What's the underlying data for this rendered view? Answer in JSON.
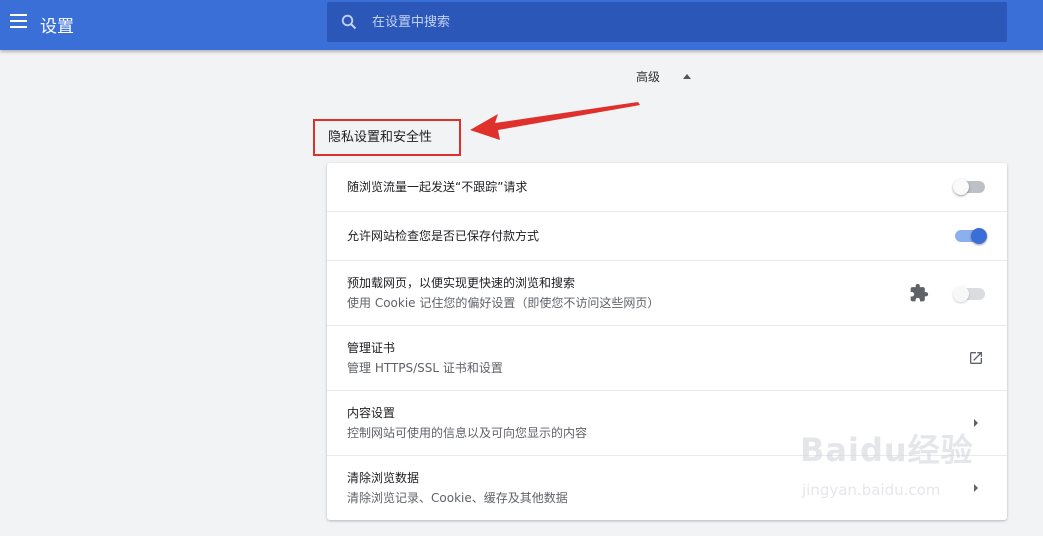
{
  "header": {
    "title": "设置",
    "search_placeholder": "在设置中搜索",
    "color": "#3b6fd8"
  },
  "advanced": {
    "label": "高级"
  },
  "section": {
    "title": "隐私设置和安全性",
    "highlight_color": "#e0302b"
  },
  "rows": [
    {
      "primary": "随浏览流量一起发送“不跟踪”请求",
      "control": "toggle",
      "state": "off"
    },
    {
      "primary": "允许网站检查您是否已保存付款方式",
      "control": "toggle",
      "state": "on"
    },
    {
      "primary": "预加载网页，以便实现更快速的浏览和搜索",
      "secondary": "使用 Cookie 记住您的偏好设置（即使您不访问这些网页）",
      "control": "toggle",
      "state": "disabled",
      "extra_icon": "puzzle-icon"
    },
    {
      "primary": "管理证书",
      "secondary": "管理 HTTPS/SSL 证书和设置",
      "control": "external-link-icon"
    },
    {
      "primary": "内容设置",
      "secondary": "控制网站可使用的信息以及可向您显示的内容",
      "control": "chevron-right-icon"
    },
    {
      "primary": "清除浏览数据",
      "secondary": "清除浏览记录、Cookie、缓存及其他数据",
      "control": "chevron-right-icon"
    }
  ],
  "watermark": {
    "logo": "Baidu经验",
    "url": "jingyan.baidu.com"
  }
}
